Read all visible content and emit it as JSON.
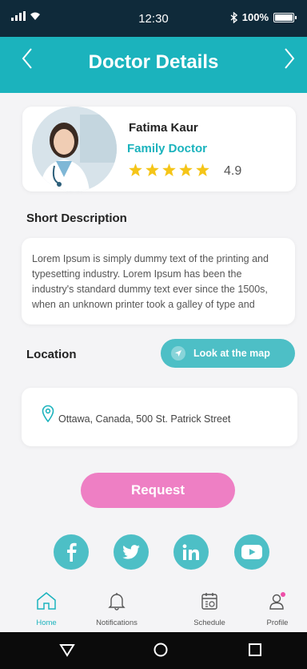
{
  "status": {
    "time": "12:30",
    "battery": "100%"
  },
  "header": {
    "title": "Doctor Details"
  },
  "doctor": {
    "name": "Fatima Kaur",
    "specialty": "Family Doctor",
    "rating": "4.9",
    "stars": 5
  },
  "description": {
    "title": "Short Description",
    "lines": [
      "Lorem Ipsum is simply dummy text of the printing and",
      "typesetting industry. Lorem Ipsum has been the",
      "industry's standard dummy text ever since the 1500s,",
      "when an unknown printer took a galley of type and"
    ]
  },
  "location": {
    "title": "Location",
    "map_button": "Look at the map",
    "address": "Ottawa, Canada, 500 St. Patrick Street"
  },
  "request_button": "Request",
  "social": [
    "facebook-icon",
    "twitter-icon",
    "linkedin-icon",
    "youtube-icon"
  ],
  "tabs": [
    {
      "label": "Home",
      "icon": "home-icon",
      "active": true
    },
    {
      "label": "Notifications",
      "icon": "bell-icon",
      "active": false
    },
    {
      "label": "Schedule",
      "icon": "calendar-icon",
      "active": false
    },
    {
      "label": "Profile",
      "icon": "profile-icon",
      "active": false
    }
  ],
  "colors": {
    "teal": "#1bb3bd",
    "teal_light": "#4dbfc6",
    "pink": "#ee7fc4",
    "star": "#f5c518",
    "status_bar": "#0f2a3a"
  }
}
